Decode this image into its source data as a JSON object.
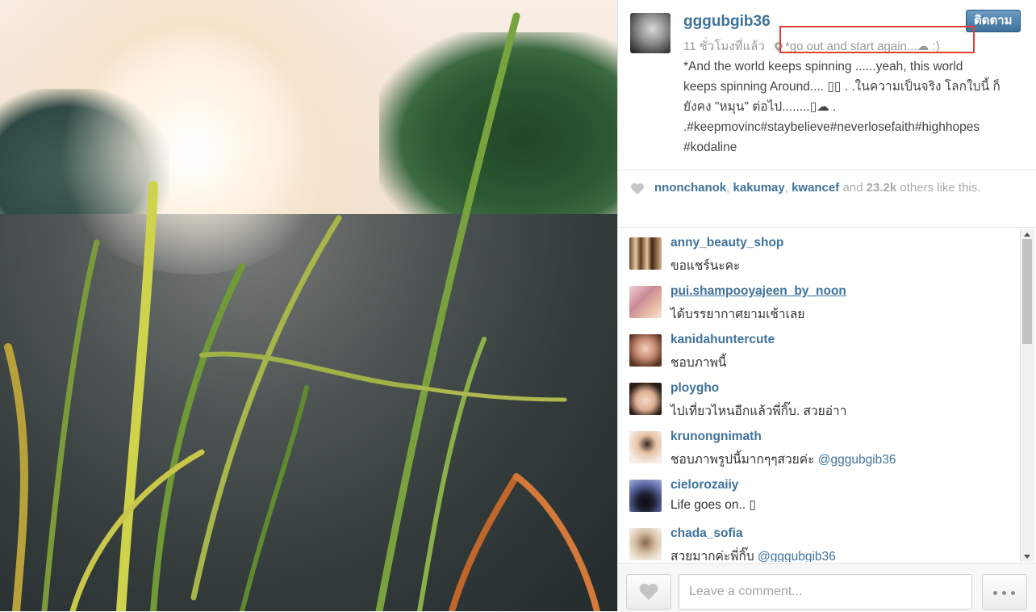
{
  "post": {
    "username": "gggubgib36",
    "follow_label": "ติดตาม",
    "time_ago": "11 ชั่วโมงที่แล้ว",
    "location": "*go out and start again...☁",
    "location_tail": ":)",
    "caption_lines": [
      "*And the world keeps spinning ......yeah, this world",
      "keeps spinning Around.... ▯▯ . .ในความเป็นจริง โลกใบนี้ ก็",
      "ยังคง \"หมุน\" ต่อไป........▯☁ .",
      ".#keepmovinc#staybelieve#neverlosefaith#highhopes",
      "#kodaline"
    ]
  },
  "likes": {
    "user1": "nnonchanok",
    "user2": "kakumay",
    "user3": "kwancef",
    "and_word": "and",
    "count": "23.2k",
    "suffix": "others like this."
  },
  "comments": [
    {
      "user": "anny_beauty_shop",
      "text": "ขอแชร์นะคะ",
      "mention": ""
    },
    {
      "user": "pui.shampooyajeen_by_noon",
      "text": "ได้บรรยากาศยามเช้าเลย",
      "mention": ""
    },
    {
      "user": "kanidahuntercute",
      "text": "ชอบภาพนี้",
      "mention": ""
    },
    {
      "user": "ploygho",
      "text": "ไปเที่ยวไหนอีกแล้วพี่กิ๊บ. สวยอ่าา",
      "mention": ""
    },
    {
      "user": "krunongnimath",
      "text": "ชอบภาพรูปนี้มากๆๆสวยค่ะ",
      "mention": "@gggubgib36"
    },
    {
      "user": "cielorozaiiy",
      "text": "Life goes on.. ▯",
      "mention": ""
    },
    {
      "user": "chada_sofia",
      "text": "สวยมากค่ะพี่กิ๊บ",
      "mention": "@gggubgib36"
    }
  ],
  "footer": {
    "comment_placeholder": "Leave a comment..."
  }
}
